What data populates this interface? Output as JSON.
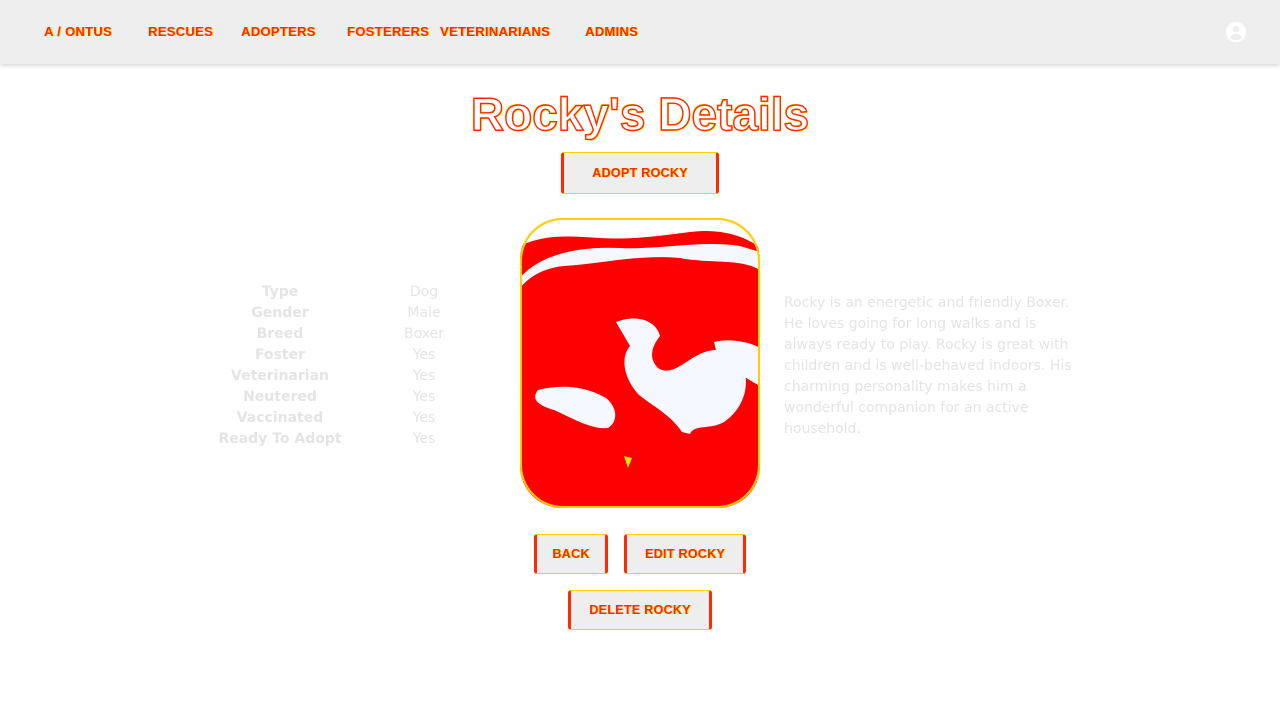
{
  "nav": {
    "items": [
      "A / ONTUS",
      "RESCUES",
      "ADOPTERS",
      "FOSTERERS",
      "VETERINARIANS",
      "ADMINS"
    ]
  },
  "account": {
    "icon": "account-circle-icon"
  },
  "page": {
    "title": "Rocky's Details",
    "adopt_label": "ADOPT ROCKY",
    "back_label": "BACK",
    "edit_label": "EDIT ROCKY",
    "delete_label": "DELETE ROCKY"
  },
  "details": [
    {
      "label": "Type",
      "value": "Dog"
    },
    {
      "label": "Gender",
      "value": "Male"
    },
    {
      "label": "Breed",
      "value": "Boxer"
    },
    {
      "label": "Foster",
      "value": "Yes"
    },
    {
      "label": "Veterinarian",
      "value": "Yes"
    },
    {
      "label": "Neutered",
      "value": "Yes"
    },
    {
      "label": "Vaccinated",
      "value": "Yes"
    },
    {
      "label": "Ready To Adopt",
      "value": "Yes"
    }
  ],
  "description": "Rocky is an energetic and friendly Boxer. He loves going for long walks and is always ready to play. Rocky is great with children and is well-behaved indoors. His charming personality makes him a wonderful companion for an active household.",
  "colors": {
    "accent": "#ff2a00",
    "highlight": "#ffd000",
    "topbar": "#eeeeee",
    "muted_text": "#e4e4e4"
  }
}
